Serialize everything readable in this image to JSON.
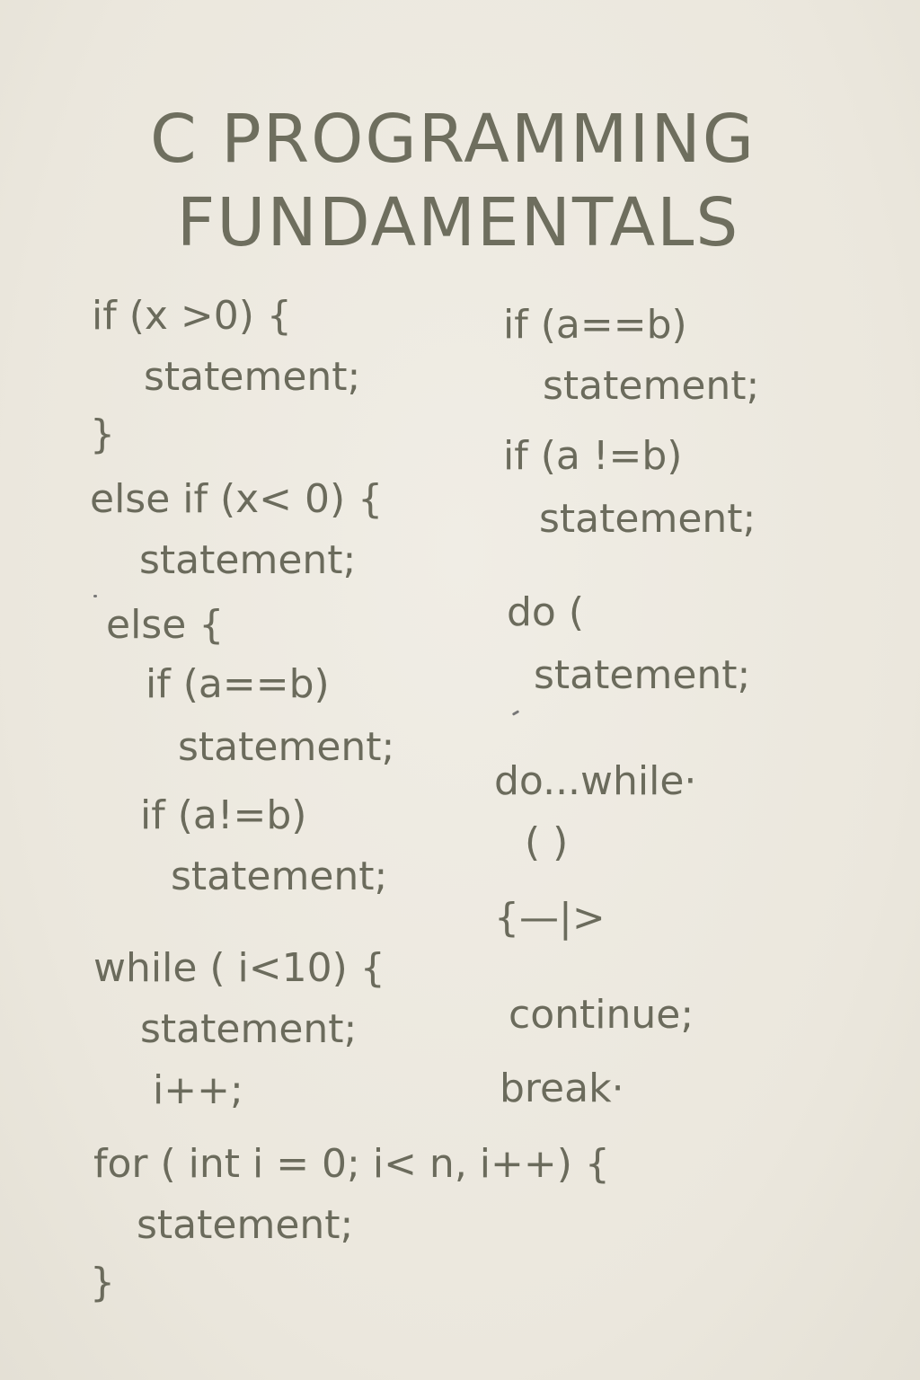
{
  "title": {
    "line1": "C PROGRAMMING",
    "line2": "FUNDAMENTALS"
  },
  "left_column": [
    "if (x >0) {",
    "statement;",
    "}",
    "else if (x< 0) {",
    "statement;",
    "else {",
    "if (a==b)",
    "statement;",
    "if (a!=b)",
    "statement;",
    "while ( i<10) {",
    "statement;",
    "i++;",
    "for ( int i = 0; i< n, i++) {",
    "statement;",
    "}"
  ],
  "right_column": [
    "if (a==b)",
    "statement;",
    "if (a !=b)",
    "statement;",
    "do (",
    "statement;",
    "do...while·",
    "( )",
    "{—|>",
    "continue;",
    "break·"
  ]
}
